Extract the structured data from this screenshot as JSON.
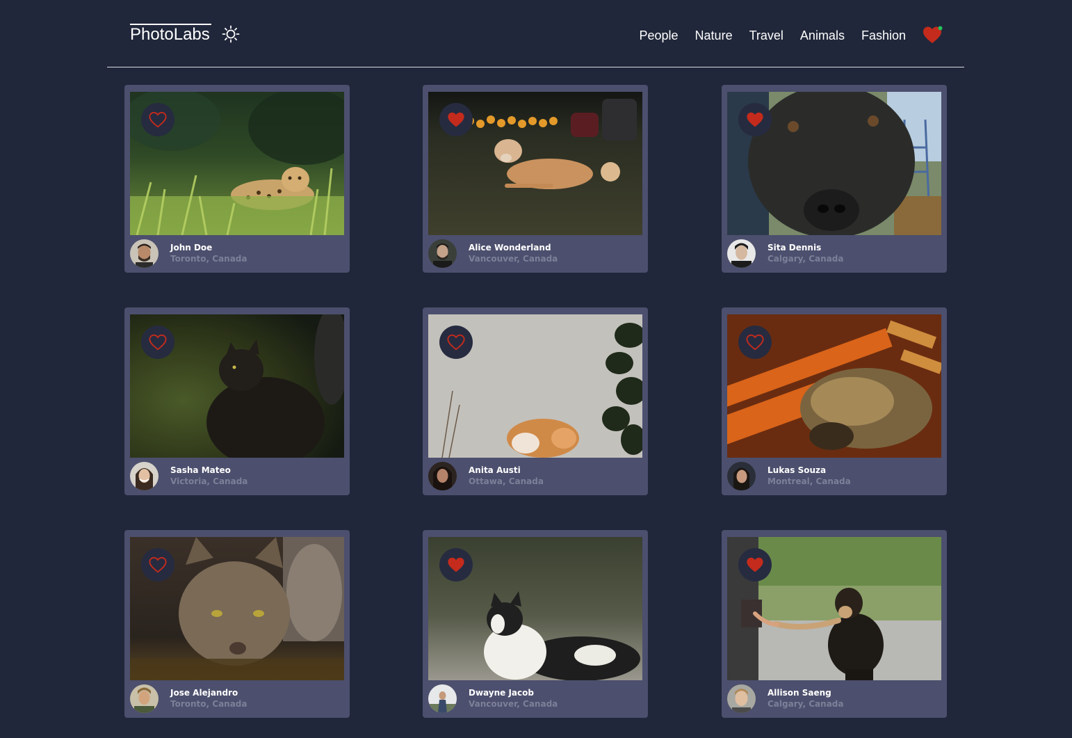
{
  "nav": {
    "logo": "PhotoLabs",
    "theme_icon": "sun-icon",
    "topics": [
      {
        "label": "People"
      },
      {
        "label": "Nature"
      },
      {
        "label": "Travel"
      },
      {
        "label": "Animals"
      },
      {
        "label": "Fashion"
      }
    ],
    "fav_icon": "heart-icon",
    "fav_has_notification": true
  },
  "colors": {
    "background": "#21273a",
    "card": "#4c4f6d",
    "heart": "#c42b1c",
    "notification": "#22c55e",
    "location": "#7d8098"
  },
  "photos": [
    {
      "username": "John Doe",
      "location": "Toronto, Canada",
      "liked": false,
      "subject": "jaguar in grass"
    },
    {
      "username": "Alice Wonderland",
      "location": "Vancouver, Canada",
      "liked": true,
      "subject": "dog lying on lawn"
    },
    {
      "username": "Sita Dennis",
      "location": "Calgary, Canada",
      "liked": true,
      "subject": "black dog close-up"
    },
    {
      "username": "Sasha Mateo",
      "location": "Victoria, Canada",
      "liked": false,
      "subject": "black cat"
    },
    {
      "username": "Anita Austi",
      "location": "Ottawa, Canada",
      "liked": false,
      "subject": "ginger cat by wall"
    },
    {
      "username": "Lukas Souza",
      "location": "Montreal, Canada",
      "liked": false,
      "subject": "tabby cat sleeping"
    },
    {
      "username": "Jose Alejandro",
      "location": "Toronto, Canada",
      "liked": false,
      "subject": "tabby cat drinking"
    },
    {
      "username": "Dwayne Jacob",
      "location": "Vancouver, Canada",
      "liked": true,
      "subject": "border collie"
    },
    {
      "username": "Allison Saeng",
      "location": "Calgary, Canada",
      "liked": true,
      "subject": "dog giving paw"
    }
  ]
}
